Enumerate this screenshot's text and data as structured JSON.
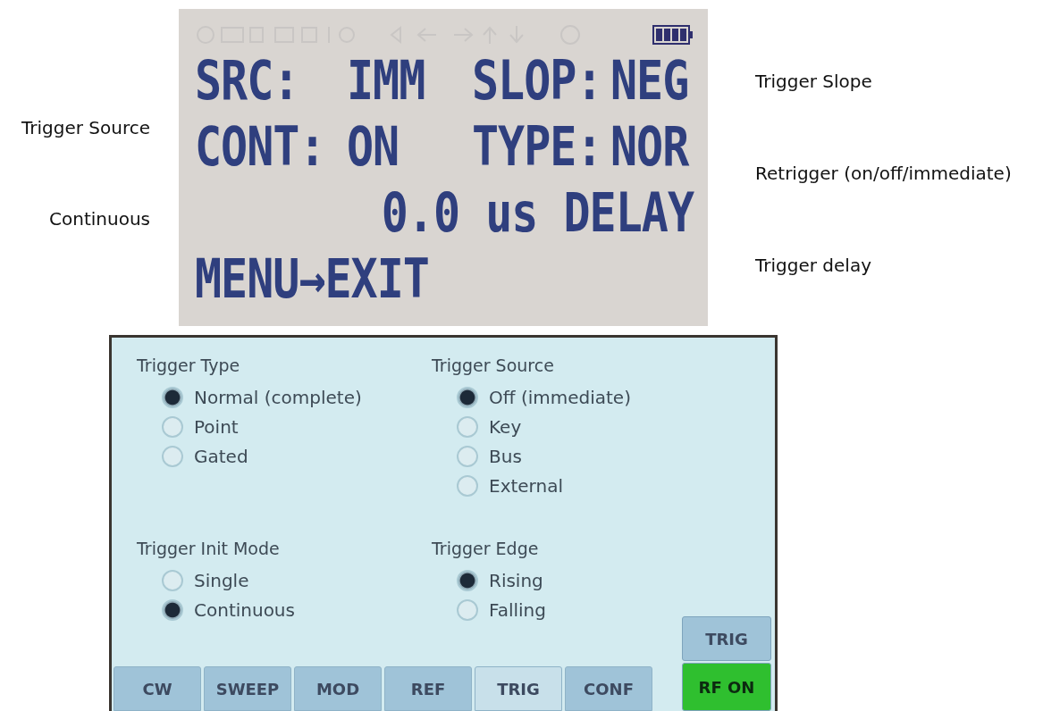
{
  "left_notes": [
    "Trigger Source",
    "Continuous"
  ],
  "lcd": {
    "rows": [
      {
        "kind": "fields",
        "cells": [
          "SRC:",
          "IMM",
          "SLOP:",
          "NEG"
        ]
      },
      {
        "kind": "fields",
        "cells": [
          "CONT:",
          "ON",
          "TYPE:",
          "NOR"
        ]
      },
      {
        "kind": "right",
        "cells": [
          "0.0 us DELAY"
        ]
      },
      {
        "kind": "left",
        "cells": [
          "MENU→EXIT"
        ]
      }
    ]
  },
  "right_notes": [
    "Trigger Slope",
    "Retrigger (on/off/immediate)",
    "Trigger delay"
  ],
  "touch": {
    "groups": [
      {
        "title": "Trigger Type",
        "options": [
          {
            "label": "Normal (complete)",
            "selected": true
          },
          {
            "label": "Point",
            "selected": false
          },
          {
            "label": "Gated",
            "selected": false
          }
        ]
      },
      {
        "title": "Trigger Source",
        "options": [
          {
            "label": "Off (immediate)",
            "selected": true
          },
          {
            "label": "Key",
            "selected": false
          },
          {
            "label": "Bus",
            "selected": false
          },
          {
            "label": "External",
            "selected": false
          }
        ]
      },
      {
        "title": "Trigger Init Mode",
        "options": [
          {
            "label": "Single",
            "selected": false
          },
          {
            "label": "Continuous",
            "selected": true
          }
        ]
      },
      {
        "title": "Trigger Edge",
        "options": [
          {
            "label": "Rising",
            "selected": true
          },
          {
            "label": "Falling",
            "selected": false
          }
        ]
      }
    ],
    "tabs": [
      {
        "label": "CW",
        "selected": false
      },
      {
        "label": "SWEEP",
        "selected": false
      },
      {
        "label": "MOD",
        "selected": false
      },
      {
        "label": "REF",
        "selected": false
      },
      {
        "label": "TRIG",
        "selected": true
      },
      {
        "label": "CONF",
        "selected": false
      }
    ],
    "side_buttons": [
      {
        "label": "TRIG",
        "kind": "plain"
      },
      {
        "label": "RF ON",
        "kind": "power"
      }
    ]
  }
}
